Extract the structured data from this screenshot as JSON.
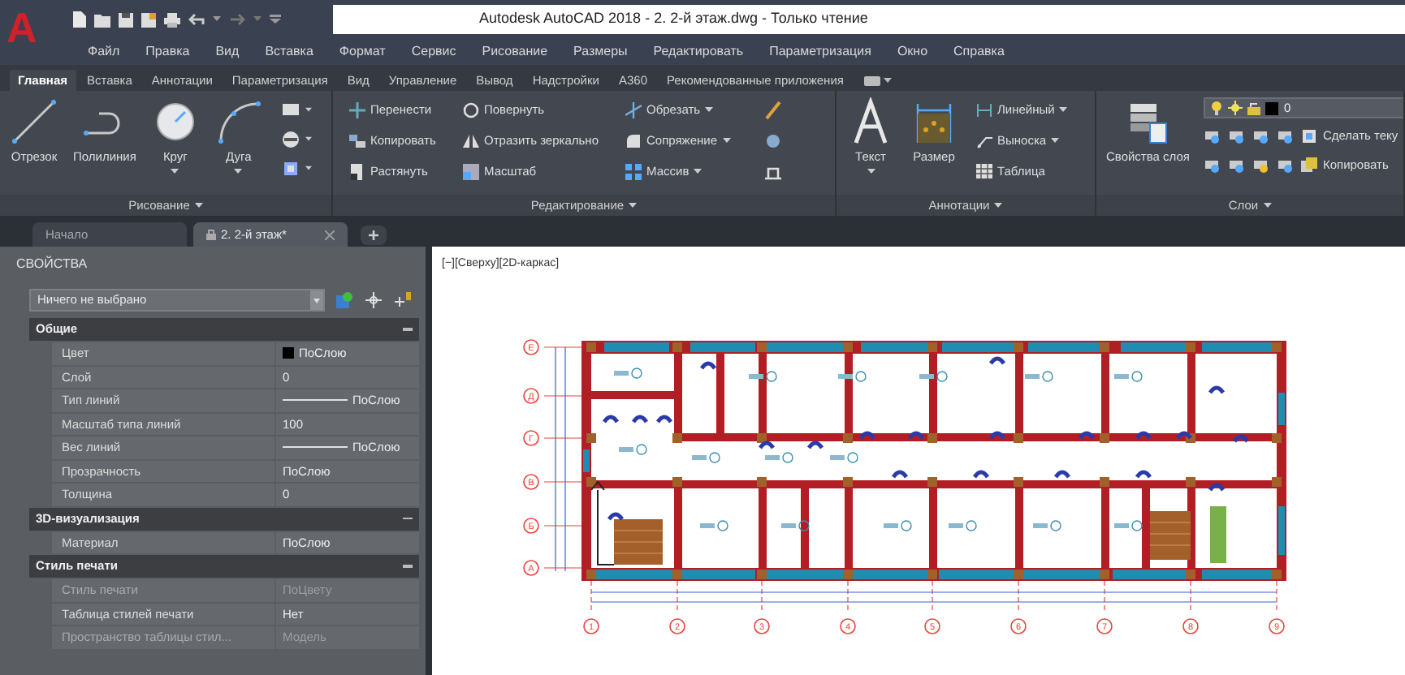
{
  "app_button": {
    "label": "A"
  },
  "window": {
    "title": "Autodesk AutoCAD 2018 - 2. 2-й этаж.dwg - Только чтение"
  },
  "menu_bar": [
    "Файл",
    "Правка",
    "Вид",
    "Вставка",
    "Формат",
    "Сервис",
    "Рисование",
    "Размеры",
    "Редактировать",
    "Параметризация",
    "Окно",
    "Справка"
  ],
  "ribbon_tabs": [
    {
      "label": "Главная",
      "selected": true
    },
    {
      "label": "Вставка",
      "selected": false
    },
    {
      "label": "Аннотации",
      "selected": false
    },
    {
      "label": "Параметризация",
      "selected": false
    },
    {
      "label": "Вид",
      "selected": false
    },
    {
      "label": "Управление",
      "selected": false
    },
    {
      "label": "Вывод",
      "selected": false
    },
    {
      "label": "Надстройки",
      "selected": false
    },
    {
      "label": "A360",
      "selected": false
    },
    {
      "label": "Рекомендованные приложения",
      "selected": false
    }
  ],
  "ribbon_panels": [
    {
      "title": "Рисование",
      "large_tools": [
        {
          "label": "Отрезок",
          "dropdown": false
        },
        {
          "label": "Полилиния",
          "dropdown": false
        },
        {
          "label": "Круг",
          "dropdown": true
        },
        {
          "label": "Дуга",
          "dropdown": true
        }
      ]
    },
    {
      "title": "Редактирование",
      "small_tools": [
        {
          "label": "Перенести",
          "dropdown": false
        },
        {
          "label": "Повернуть",
          "dropdown": false
        },
        {
          "label": "Обрезать",
          "dropdown": true
        },
        {
          "label": "Копировать",
          "dropdown": false
        },
        {
          "label": "Отразить зеркально",
          "dropdown": false
        },
        {
          "label": "Сопряжение",
          "dropdown": true
        },
        {
          "label": "Растянуть",
          "dropdown": false
        },
        {
          "label": "Масштаб",
          "dropdown": false
        },
        {
          "label": "Массив",
          "dropdown": true
        }
      ]
    },
    {
      "title": "Аннотации",
      "large_tools": [
        {
          "label": "Текст",
          "dropdown": true
        },
        {
          "label": "Размер",
          "dropdown": false
        }
      ],
      "small_tools": [
        {
          "label": "Линейный",
          "dropdown": true
        },
        {
          "label": "Выноска",
          "dropdown": true
        },
        {
          "label": "Таблица",
          "dropdown": false
        }
      ]
    },
    {
      "title": "Слои",
      "large_tools": [
        {
          "label": "Свойства слоя",
          "dropdown": false
        }
      ],
      "layer_value": "0",
      "small_tools": [
        {
          "label": "Сделать теку",
          "dropdown": false
        },
        {
          "label": "Копировать",
          "dropdown": false
        }
      ]
    }
  ],
  "document_tabs": [
    {
      "label": "Начало",
      "selected": false,
      "locked": false,
      "closable": false
    },
    {
      "label": "2. 2-й этаж*",
      "selected": true,
      "locked": true,
      "closable": true
    }
  ],
  "properties": {
    "title": "СВОЙСТВА",
    "selection": "Ничего не выбрано",
    "groups": [
      {
        "title": "Общие",
        "expanded": true,
        "rows": [
          {
            "name": "Цвет",
            "value": "ПоСлою",
            "kind": "color",
            "color": "#000000",
            "disabled": false
          },
          {
            "name": "Слой",
            "value": "0",
            "kind": "text",
            "disabled": false
          },
          {
            "name": "Тип линий",
            "value": "ПоСлою",
            "kind": "linetype",
            "disabled": false
          },
          {
            "name": "Масштаб типа линий",
            "value": "100",
            "kind": "text",
            "disabled": false
          },
          {
            "name": "Вес линий",
            "value": "ПоСлою",
            "kind": "linetype",
            "disabled": false
          },
          {
            "name": "Прозрачность",
            "value": "ПоСлою",
            "kind": "text",
            "disabled": false
          },
          {
            "name": "Толщина",
            "value": "0",
            "kind": "text",
            "disabled": false
          }
        ]
      },
      {
        "title": "3D-визуализация",
        "expanded": true,
        "rows": [
          {
            "name": "Материал",
            "value": "ПоСлою",
            "kind": "text",
            "disabled": false
          }
        ]
      },
      {
        "title": "Стиль печати",
        "expanded": true,
        "rows": [
          {
            "name": "Стиль печати",
            "value": "ПоЦвету",
            "kind": "text",
            "disabled": true
          },
          {
            "name": "Таблица стилей печати",
            "value": "Нет",
            "kind": "text",
            "disabled": false
          },
          {
            "name": "Пространство таблицы стил...",
            "value": "Модель",
            "kind": "text",
            "disabled": true
          }
        ]
      }
    ]
  },
  "viewport": {
    "label": "[−][Сверху][2D-каркас]",
    "row_axes": [
      "Е",
      "Д",
      "Г",
      "В",
      "Б",
      "А"
    ],
    "column_axes": [
      "1",
      "2",
      "3",
      "4",
      "5",
      "6",
      "7",
      "8",
      "9"
    ]
  }
}
